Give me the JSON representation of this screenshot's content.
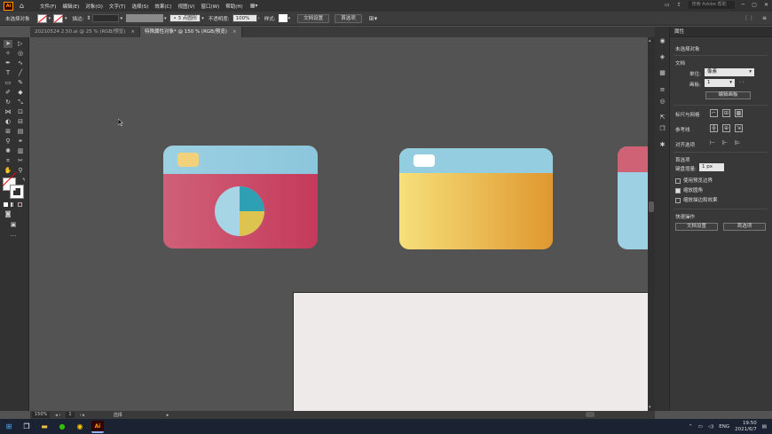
{
  "menubar": {
    "logo": "Ai",
    "items": [
      "文件(F)",
      "编辑(E)",
      "对象(O)",
      "文字(T)",
      "选择(S)",
      "效果(C)",
      "视图(V)",
      "窗口(W)",
      "帮助(H)"
    ],
    "workspace_icon": "workspace-grid",
    "search_placeholder": "搜索 Adobe 帮助"
  },
  "control_bar": {
    "selection_label": "未选择对象",
    "stroke_label": "描边:",
    "stroke_value": "",
    "brush_value": "3 点圆形",
    "opacity_label": "不透明度:",
    "opacity_value": "100%",
    "style_label": "样式:",
    "doc_setup": "文档设置",
    "prefs": "首选项"
  },
  "tabs": [
    {
      "label": "20210524 2.50.ai @ 25 % (RGB/预览)",
      "close": "×"
    },
    {
      "label": "特殊属性对象* @ 150 % (RGB/预览)",
      "close": "×"
    }
  ],
  "properties": {
    "panel_title": "属性",
    "no_selection": "未选择对象",
    "document_section": "文档",
    "units_label": "单位:",
    "units_value": "像素",
    "artboard_label": "画板:",
    "artboard_value": "1",
    "edit_artboards_btn": "编辑画板",
    "rulers_grids": "标尺与网格",
    "guides": "参考线",
    "align_options": "对齐选项",
    "preferences_section": "首选项",
    "keyboard_increment_label": "键盘增量:",
    "keyboard_increment_value": "1 px",
    "check_preview_bounds": "使用预览边界",
    "check_scale_corners": "缩放圆角",
    "check_scale_strokes": "缩放描边和效果",
    "quick_actions": "快速操作",
    "doc_setup_btn": "文档设置",
    "prefs_btn": "首选项"
  },
  "status": {
    "zoom": "150%",
    "artboard": "1",
    "tool": "选择"
  },
  "taskbar": {
    "lang": "ENG",
    "time": "19:50",
    "date": "2021/6/7"
  },
  "colors": {
    "card1_top": "#90c9de",
    "card1_bottom_start": "#cf5c73",
    "card1_bottom_end": "#c63a5c",
    "card2_top": "#90c9de",
    "card2_bottom_start": "#f5de76",
    "card2_bottom_end": "#e19a34",
    "pie_teal": "#2fa0b4",
    "pie_light": "#a6d6e6",
    "pie_yellow": "#ddc350"
  }
}
